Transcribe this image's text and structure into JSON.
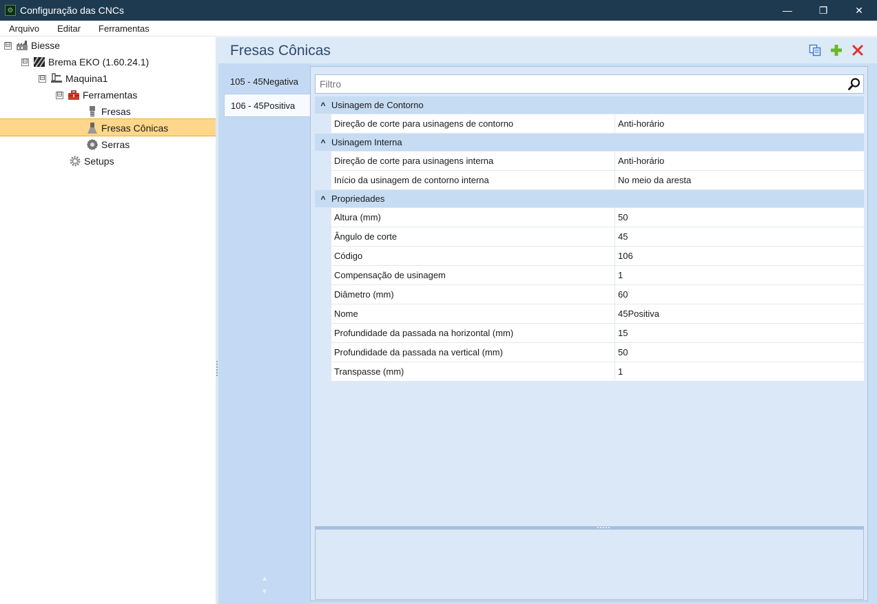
{
  "window": {
    "title": "Configuração das CNCs",
    "minimize": "—",
    "restore": "❐",
    "close": "✕"
  },
  "menu": {
    "items": [
      "Arquivo",
      "Editar",
      "Ferramentas"
    ]
  },
  "tree": {
    "expand_glyph": "⊟",
    "items": [
      {
        "label": "Biesse",
        "icon": "factory-icon"
      },
      {
        "label": "Brema EKO (1.60.24.1)",
        "icon": "machine-stripes-icon"
      },
      {
        "label": "Maquina1",
        "icon": "machine-icon"
      },
      {
        "label": "Ferramentas",
        "icon": "toolbox-icon"
      },
      {
        "label": "Fresas",
        "icon": "mill-bit-icon"
      },
      {
        "label": "Fresas Cônicas",
        "icon": "conical-bit-icon",
        "selected": true
      },
      {
        "label": "Serras",
        "icon": "saw-blade-icon"
      },
      {
        "label": "Setups",
        "icon": "gear-icon"
      }
    ]
  },
  "header": {
    "title": "Fresas Cônicas"
  },
  "tabs": [
    {
      "label": "105 - 45Negativa"
    },
    {
      "label": "106 - 45Positiva",
      "active": true
    }
  ],
  "tab_scroll": {
    "up": "▲",
    "down": "▼"
  },
  "filter": {
    "placeholder": "Filtro"
  },
  "categories": [
    {
      "name": "Usinagem de Contorno",
      "rows": [
        {
          "name": "Direção de corte para usinagens de contorno",
          "value": "Anti-horário"
        }
      ]
    },
    {
      "name": "Usinagem Interna",
      "rows": [
        {
          "name": "Direção de corte para usinagens interna",
          "value": "Anti-horário"
        },
        {
          "name": "Início da usinagem de contorno interna",
          "value": "No meio da aresta"
        }
      ]
    },
    {
      "name": "Propriedades",
      "rows": [
        {
          "name": "Altura (mm)",
          "value": "50"
        },
        {
          "name": "Ângulo de corte",
          "value": "45"
        },
        {
          "name": "Código",
          "value": "106"
        },
        {
          "name": "Compensação de usinagem",
          "value": "1"
        },
        {
          "name": "Diâmetro (mm)",
          "value": "60"
        },
        {
          "name": "Nome",
          "value": "45Positiva"
        },
        {
          "name": "Profundidade da passada na horizontal (mm)",
          "value": "15"
        },
        {
          "name": "Profundidade da passada na vertical (mm)",
          "value": "50"
        },
        {
          "name": "Transpasse (mm)",
          "value": "1"
        }
      ]
    }
  ],
  "colors": {
    "titlebar": "#1e3a50",
    "selection": "#ffd78a",
    "accent_add": "#6ab82a",
    "accent_delete": "#e03030"
  }
}
